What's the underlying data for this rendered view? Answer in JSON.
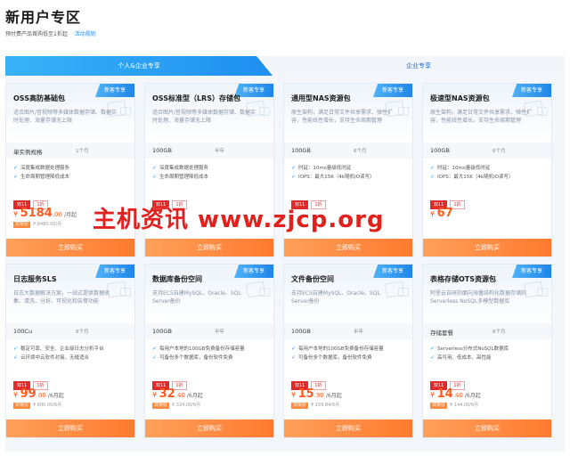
{
  "page": {
    "title": "新用户专区",
    "subtitle": "预付费产品首购低至1折起",
    "rules_link": "活动规则"
  },
  "tabs": [
    {
      "label": "个人&企业专享",
      "active": true
    },
    {
      "label": "企业专享",
      "active": false
    }
  ],
  "colors": {
    "accent": "#1a8cff",
    "price": "#ff5a1f",
    "buy_button": "#ff7a2f",
    "tag_red": "#e02b2b"
  },
  "cards": [
    {
      "badge": "新客专享",
      "title": "OSS高防基础包",
      "desc": "适合图片/音视频等多媒体数据存储、数据实时处理、海量存储无上限",
      "spec": "单实例规格",
      "duration": "1个月",
      "features": [
        "深度集成数据处理服务",
        "生命周期管理降低成本"
      ],
      "tags": [
        "双11",
        "1折"
      ],
      "price_int": "5184",
      "price_dec": ".00",
      "price_unit": "/月起",
      "orig_pill": "日常价",
      "orig_price": "¥ 8480.00/月",
      "buy": "立即购买"
    },
    {
      "badge": "新客专享",
      "title": "OSS标准型（LRS）存储包",
      "desc": "适合图片/音视频等多媒体数据存储、数据实时处理、海量存储无上限",
      "spec": "100GB",
      "duration": "半年",
      "features": [
        "深度集成数据处理服务",
        "生命周期管理降低成本"
      ],
      "tags": [
        "双11",
        "1折"
      ],
      "price_int": "",
      "price_dec": "",
      "price_unit": "",
      "orig_pill": "",
      "orig_price": "",
      "buy": "立即购买"
    },
    {
      "badge": "新客专享",
      "title": "通用型NAS资源包",
      "desc": "原生架构，满足日常文件共享需求，弹性扩容，性能线性增长，支持生命周期管理",
      "spec": "100GB",
      "duration": "6个月",
      "features": [
        "时延：10ms量级低时延",
        "IOPS：最大15K（4k随机IO读写）"
      ],
      "tags": [
        "双11",
        "1折"
      ],
      "price_int": "",
      "price_dec": "",
      "price_unit": "",
      "orig_pill": "",
      "orig_price": "",
      "buy": "立即购买"
    },
    {
      "badge": "新客专享",
      "title": "极速型NAS资源包",
      "desc": "原生架构，满足日常文件共享需求，弹性扩容，性能线性增长，支持生命周期管理",
      "spec": "100GB",
      "duration": "6个月",
      "features": [
        "时延：10ms量级低时延",
        "IOPS：最大15K（4k随机IO读写）"
      ],
      "tags": [
        "双11",
        "1折"
      ],
      "price_int": "67",
      "price_dec": "",
      "price_unit": "",
      "orig_pill": "",
      "orig_price": "",
      "buy": "立即购买"
    },
    {
      "badge": "新客专享",
      "title": "日志服务SLS",
      "desc": "日志大数据解决方案，一站式提供数据收集、清洗、分析、可视化和告警功能",
      "spec": "100Cu",
      "duration": "6个月",
      "features": [
        "稳定可靠、安全、企业级日志分析平台",
        "云环境中云软件对接，无缝适合"
      ],
      "tags": [
        "双11",
        "1折"
      ],
      "price_int": "99",
      "price_dec": ".00",
      "price_unit": "/6月起",
      "orig_pill": "日常价",
      "orig_price": "¥ 600.00/6月",
      "buy": "立即购买"
    },
    {
      "badge": "新客专享",
      "title": "数据库备份空间",
      "desc": "支持ECS自建MySQL、Oracle、SQL Server备份",
      "spec": "100GB",
      "duration": "半年",
      "features": [
        "每用户本地的100GB免费备份存储容量",
        "可备份多个数据库，备份软件免费"
      ],
      "tags": [
        "双11",
        "1折"
      ],
      "price_int": "32",
      "price_dec": ".40",
      "price_unit": "/6月起",
      "orig_pill": "日常价",
      "orig_price": "¥ 324.00/6月",
      "buy": "立即购买"
    },
    {
      "badge": "新客专享",
      "title": "文件备份空间",
      "desc": "支持ECS自建MySQL、Oracle、SQL Server备份",
      "spec": "100GB",
      "duration": "半年",
      "features": [
        "每用户本地的100GB免费备份存储容量",
        "可备份多个数据库，备份软件免费"
      ],
      "tags": [
        "双11",
        "1折"
      ],
      "price_int": "15",
      "price_dec": ".90",
      "price_unit": "/6月起",
      "orig_pill": "日常价",
      "orig_price": "¥ 159.84/6月",
      "buy": "立即购买"
    },
    {
      "badge": "新客专享",
      "title": "表格存储OTS资源包",
      "desc": "阿里云自研的面向海量结构化数据存储的Serverless NoSQL多模型数据库",
      "spec": "存储套餐",
      "duration": "6个月",
      "features": [
        "Serverless分布式NoSQL数据库",
        "高可用、低成本、高性能"
      ],
      "tags": [
        "双11",
        "1折"
      ],
      "price_int": "14",
      "price_dec": ".40",
      "price_unit": "/6月起",
      "orig_pill": "日常价",
      "orig_price": "¥ 144.00/6月",
      "buy": "立即购买"
    }
  ],
  "watermark": "主机资讯 www.zjcp.org"
}
